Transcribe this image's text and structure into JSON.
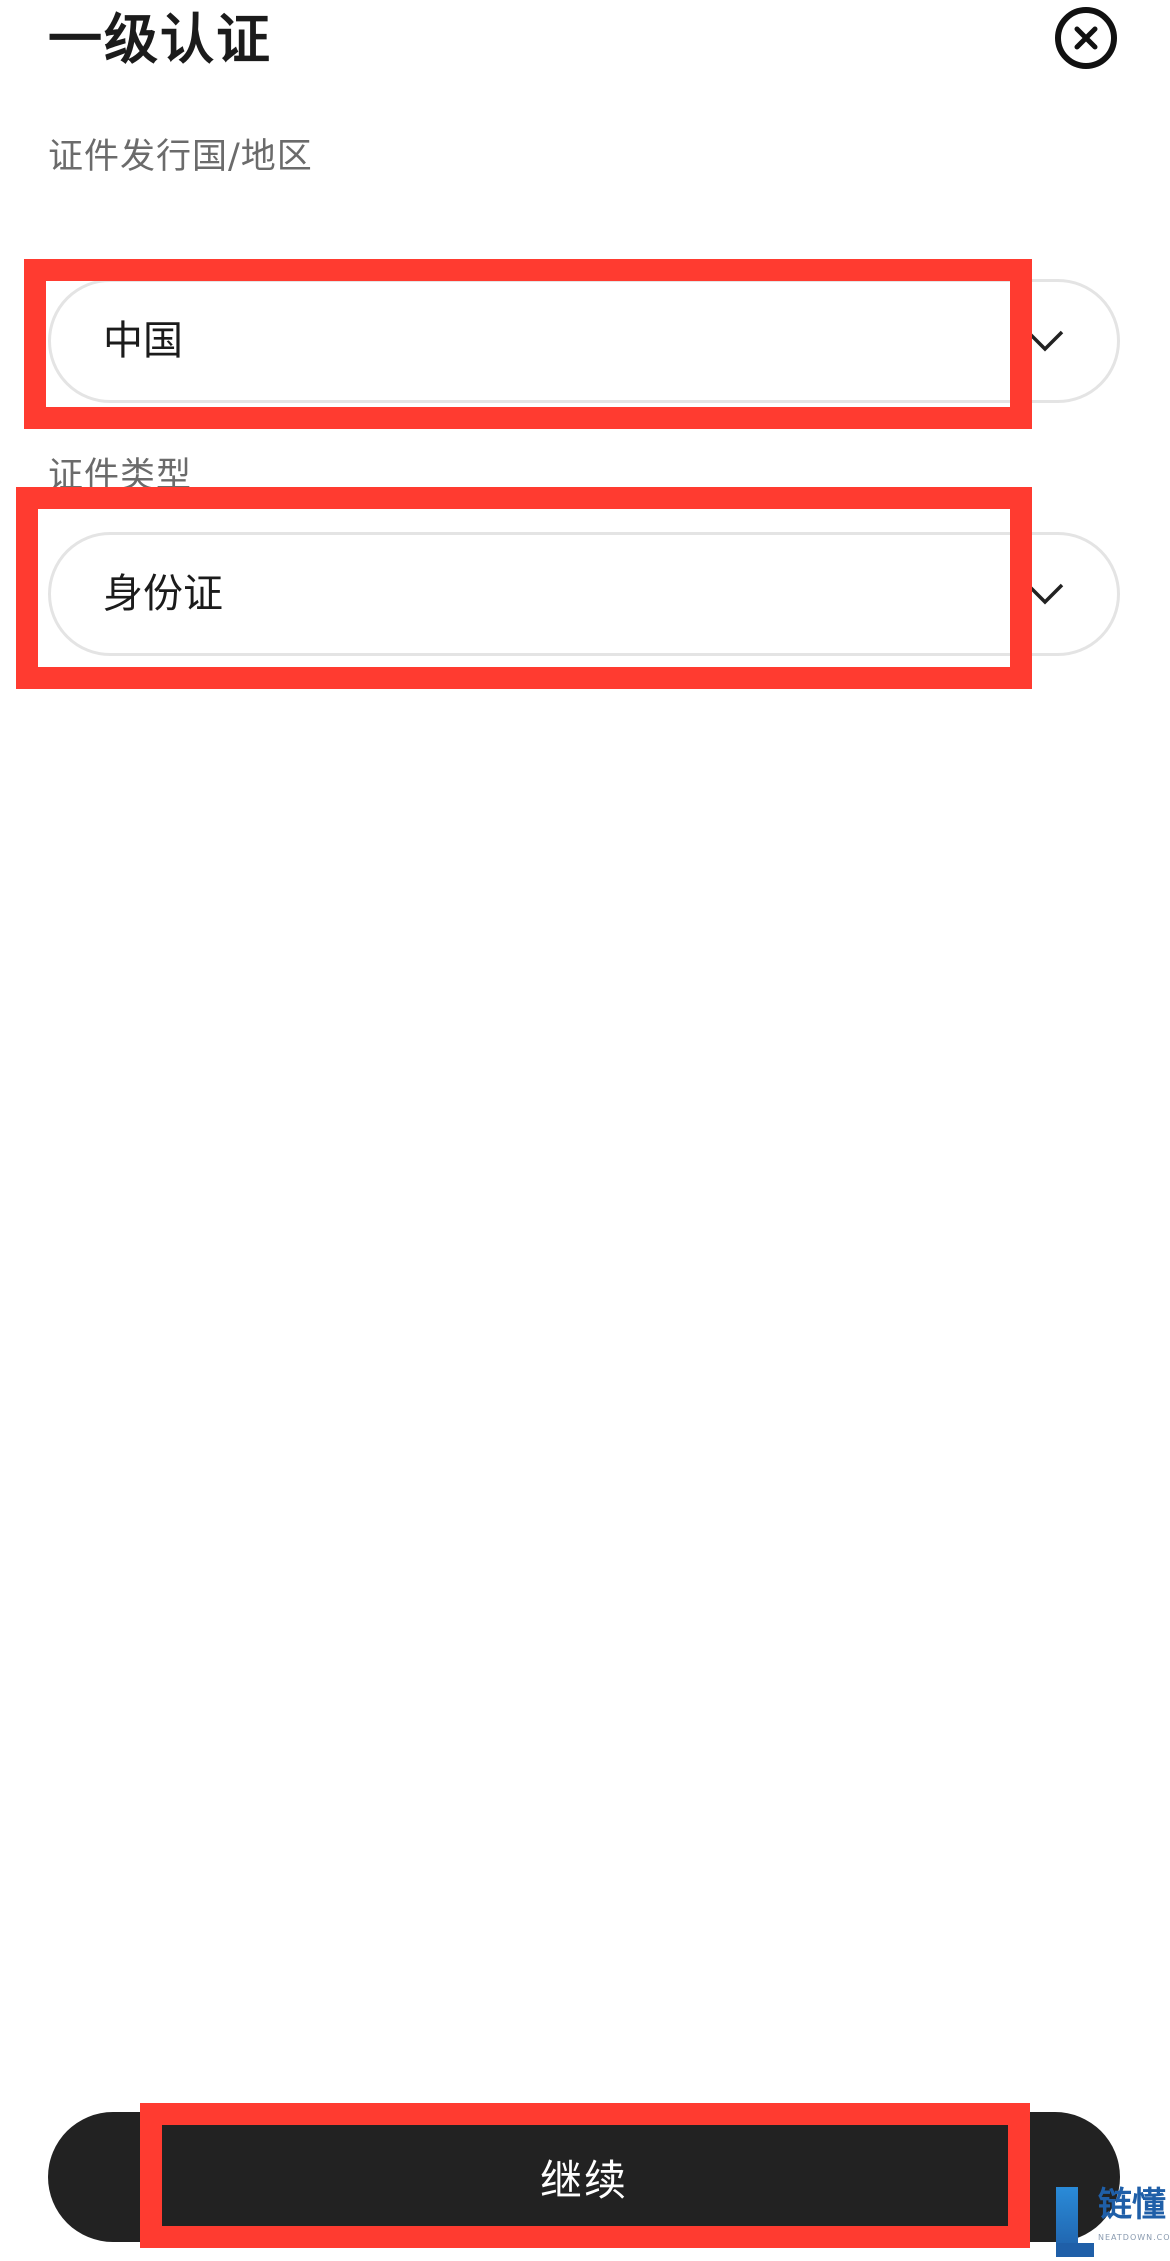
{
  "header": {
    "title": "一级认证",
    "close_icon": "close-circle-icon"
  },
  "form": {
    "country": {
      "label": "证件发行国/地区",
      "value": "中国",
      "icon": "chevron-down-icon"
    },
    "id_type": {
      "label": "证件类型",
      "value": "身份证",
      "icon": "chevron-down-icon"
    }
  },
  "footer": {
    "continue_label": "继续"
  },
  "watermark": {
    "text": "链懂",
    "sub": "NEATDOWN.COM"
  },
  "colors": {
    "annotation": "#ff3b30",
    "button_bg": "#222222",
    "watermark": "#1f5fa8"
  }
}
